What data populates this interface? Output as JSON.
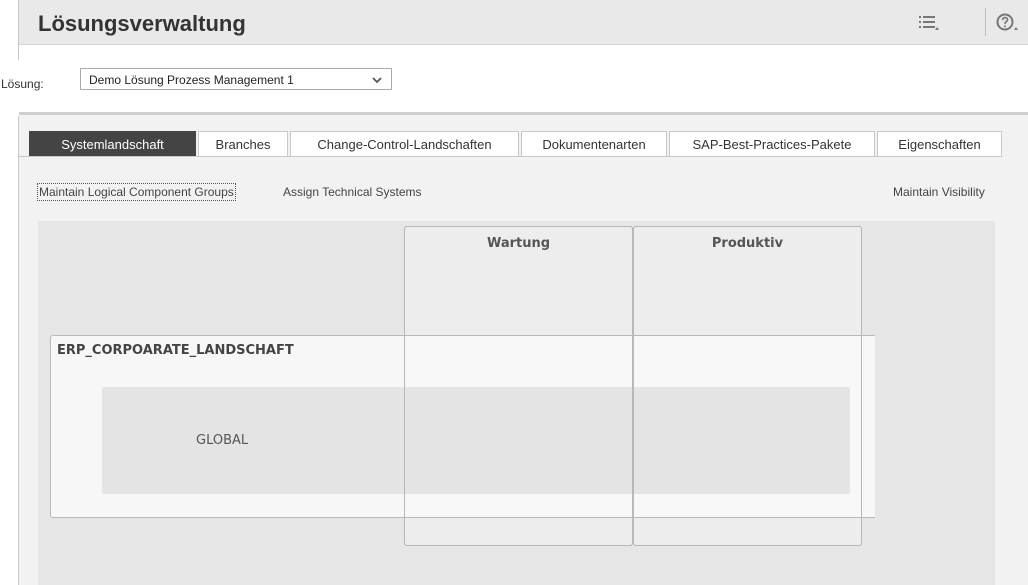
{
  "header": {
    "title": "Lösungsverwaltung",
    "icons": [
      "list-menu-icon",
      "help-icon"
    ]
  },
  "solution": {
    "label": "Lösung:",
    "selected": "Demo Lösung Prozess Management 1"
  },
  "tabs": [
    {
      "label": "Systemlandschaft",
      "active": true
    },
    {
      "label": "Branches",
      "active": false
    },
    {
      "label": "Change-Control-Landschaften",
      "active": false
    },
    {
      "label": "Dokumentenarten",
      "active": false
    },
    {
      "label": "SAP-Best-Practices-Pakete",
      "active": false
    },
    {
      "label": "Eigenschaften",
      "active": false
    }
  ],
  "subnav": {
    "maintain_groups": "Maintain Logical Component Groups",
    "assign_systems": "Assign Technical Systems",
    "maintain_visibility": "Maintain Visibility"
  },
  "landscape": {
    "columns": [
      "Wartung",
      "Produktiv"
    ],
    "landscape_name": "ERP_CORPOARATE_LANDSCHAFT",
    "group_name": "GLOBAL"
  },
  "colors": {
    "active_tab": "#444444",
    "header_bg": "#e9e9e9",
    "canvas_bg": "#e6e6e6"
  }
}
